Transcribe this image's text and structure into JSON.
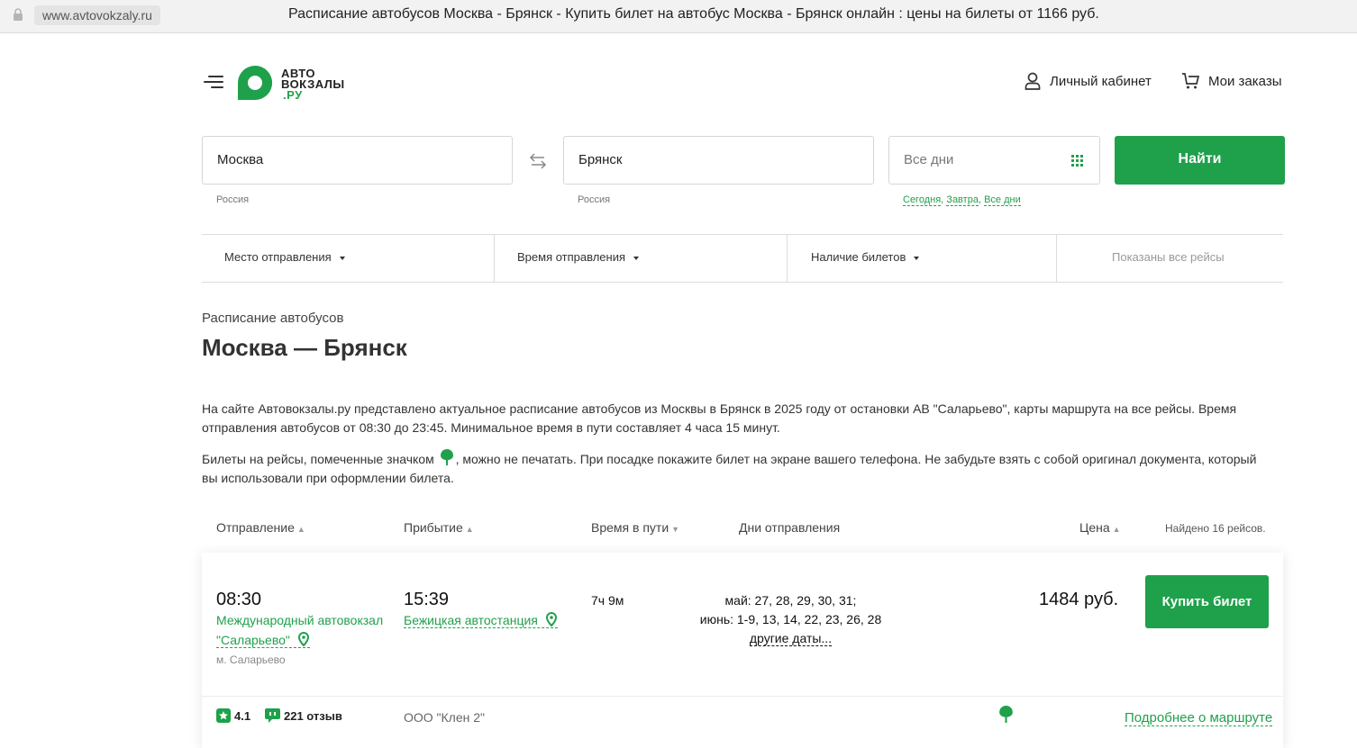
{
  "browser": {
    "url": "www.avtovokzaly.ru",
    "title": "Расписание автобусов Москва - Брянск - Купить билет на автобус Москва - Брянск онлайн : цены на билеты от 1166 руб."
  },
  "header": {
    "logo_line1": "АВТО",
    "logo_line2": "ВОКЗАЛЫ",
    "logo_line3": ".РУ",
    "account_label": "Личный кабинет",
    "orders_label": "Мои заказы"
  },
  "search": {
    "from_value": "Москва",
    "from_hint": "Россия",
    "to_value": "Брянск",
    "to_hint": "Россия",
    "date_placeholder": "Все дни",
    "date_today": "Сегодня",
    "date_tomorrow": "Завтра",
    "date_all": "Все дни",
    "find_label": "Найти"
  },
  "filters": {
    "departure_place": "Место отправления",
    "departure_time": "Время отправления",
    "tickets": "Наличие билетов",
    "status": "Показаны все рейсы"
  },
  "content": {
    "kicker": "Расписание автобусов",
    "heading": "Москва — Брянск",
    "para1": "На сайте Автовокзалы.ру представлено актуальное расписание автобусов из Москвы в Брянск в 2025 году от остановки АВ \"Саларьево\", карты маршрута на все рейсы. Время отправления автобусов от 08:30 до 23:45. Минимальное время в пути составляет 4 часа 15 минут.",
    "para2_before": "Билеты на рейсы, помеченные значком",
    "para2_after": ", можно не печатать. При посадке покажите билет на экране вашего телефона. Не забудьте взять с собой оригинал документа, который вы использовали при оформлении билета."
  },
  "table_header": {
    "departure": "Отправление",
    "arrival": "Прибытие",
    "duration": "Время в пути",
    "days": "Дни отправления",
    "price": "Цена",
    "found": "Найдено 16 рейсов."
  },
  "trip": {
    "dep_time": "08:30",
    "dep_station_line1": "Международный автовокзал",
    "dep_station_line2": "\"Саларьево\"",
    "dep_metro": "м. Саларьево",
    "arr_time": "15:39",
    "arr_station": "Бежицкая автостанция",
    "duration": "7ч 9м",
    "days_may": "май: 27, 28, 29, 30, 31;",
    "days_june": "июнь: 1-9, 13, 14, 22, 23, 26, 28",
    "days_other": "другие даты...",
    "price": "1484 руб.",
    "buy_label": "Купить билет",
    "rating": "4.1",
    "reviews": "221 отзыв",
    "carrier": "ООО \"Клен 2\"",
    "details_link": "Подробнее о маршруте"
  },
  "colors": {
    "brand_green": "#1fa14b"
  },
  "icons": [
    "lock-icon",
    "menu-icon",
    "user-icon",
    "cart-icon",
    "swap-icon",
    "calendar-grid-icon",
    "tree-icon",
    "pin-icon",
    "star-icon",
    "review-icon"
  ]
}
